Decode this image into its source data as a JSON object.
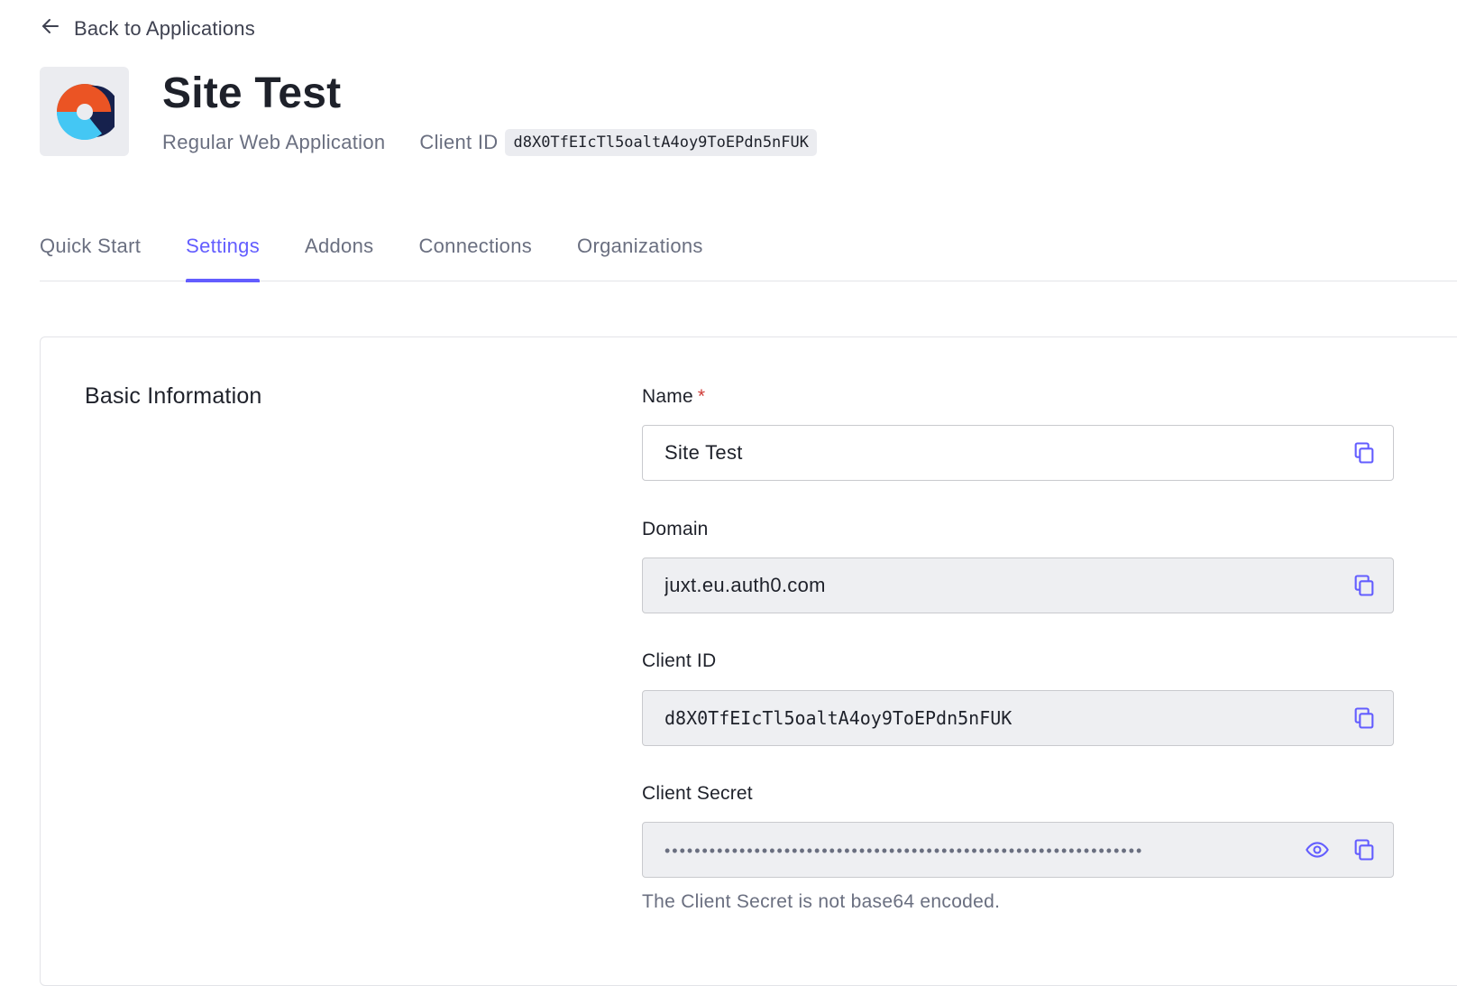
{
  "back_link": {
    "label": "Back to Applications",
    "icon": "arrow-left-icon"
  },
  "app": {
    "name": "Site Test",
    "type": "Regular Web Application",
    "client_id_label": "Client ID",
    "client_id": "d8X0TfEIcTl5oaltA4oy9ToEPdn5nFUK"
  },
  "tabs": [
    {
      "label": "Quick Start",
      "active": false
    },
    {
      "label": "Settings",
      "active": true
    },
    {
      "label": "Addons",
      "active": false
    },
    {
      "label": "Connections",
      "active": false
    },
    {
      "label": "Organizations",
      "active": false
    }
  ],
  "basic_information": {
    "title": "Basic Information",
    "name_field": {
      "label": "Name",
      "required_mark": "*",
      "value": "Site Test"
    },
    "domain_field": {
      "label": "Domain",
      "value": "juxt.eu.auth0.com"
    },
    "client_id_field": {
      "label": "Client ID",
      "value": "d8X0TfEIcTl5oaltA4oy9ToEPdn5nFUK"
    },
    "client_secret_field": {
      "label": "Client Secret",
      "masked_value": "••••••••••••••••••••••••••••••••••••••••••••••••••••••••••••••••",
      "help": "The Client Secret is not base64 encoded."
    }
  },
  "colors": {
    "accent": "#635dff",
    "text_primary": "#1e212a",
    "text_secondary": "#6a6f80",
    "required": "#d03c38",
    "readonly_bg": "#eeeff2"
  }
}
